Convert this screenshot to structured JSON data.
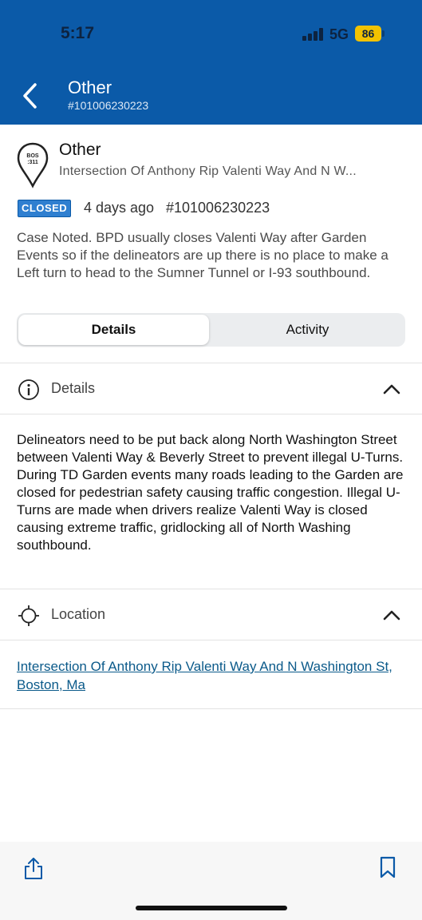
{
  "status_bar": {
    "time": "5:17",
    "network": "5G",
    "battery": "86"
  },
  "nav": {
    "title": "Other",
    "case_number": "#101006230223"
  },
  "case": {
    "icon_text_line1": "BOS",
    "icon_text_line2": ":311",
    "category": "Other",
    "address_truncated": "Intersection Of Anthony Rip Valenti Way And N W...",
    "status": "CLOSED",
    "age": "4 days ago",
    "case_number": "#101006230223",
    "note": "Case Noted. BPD usually closes Valenti Way after Garden Events so if the delineators are up there is no place to make a Left turn to head to the Sumner Tunnel or I-93 southbound."
  },
  "tabs": {
    "details": "Details",
    "activity": "Activity",
    "active": "Details"
  },
  "details_section": {
    "label": "Details",
    "body": "Delineators need to be put back along North Washington Street between Valenti Way & Beverly Street to prevent illegal U-Turns. During TD Garden events many roads leading to the Garden are closed for pedestrian safety causing traffic congestion. Illegal U-Turns are made when drivers realize Valenti Way is closed causing extreme traffic, gridlocking all of North Washing southbound."
  },
  "location_section": {
    "label": "Location",
    "address_link": "Intersection Of Anthony Rip Valenti Way And N Washington St, Boston, Ma"
  },
  "colors": {
    "header": "#0b5aa8",
    "status_badge": "#2f7fd0",
    "link": "#0b5a8a",
    "battery": "#f2c200"
  }
}
